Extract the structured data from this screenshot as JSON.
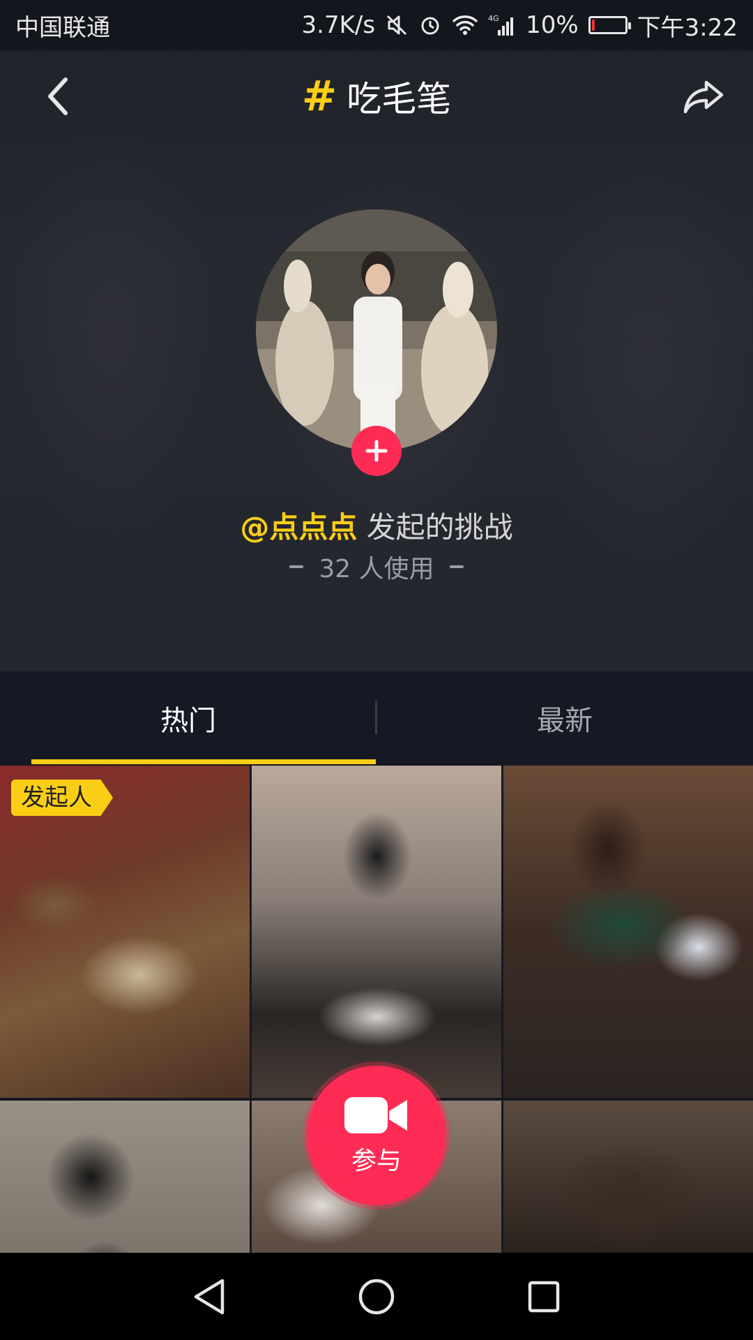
{
  "status_bar": {
    "carrier": "中国联通",
    "speed": "3.7K/s",
    "network": "4G",
    "battery_percent": "10%",
    "time": "下午3:22",
    "battery_level": 0.1
  },
  "header": {
    "hash_symbol": "#",
    "title": "吃毛笔"
  },
  "challenge": {
    "initiator_user": "@点点点",
    "initiator_suffix": " 发起的挑战",
    "usage_text": "32 人使用"
  },
  "tabs": [
    {
      "label": "热门",
      "active": true
    },
    {
      "label": "最新",
      "active": false
    }
  ],
  "grid": {
    "badge_label": "发起人",
    "videos": [
      {
        "name": "video-1"
      },
      {
        "name": "video-2"
      },
      {
        "name": "video-3"
      },
      {
        "name": "video-4"
      },
      {
        "name": "video-5"
      },
      {
        "name": "video-6"
      }
    ]
  },
  "join_button": {
    "label": "参与",
    "icon": "video-camera-icon"
  },
  "colors": {
    "accent_yellow": "#face15",
    "accent_red": "#fe2c55",
    "background": "#161823"
  },
  "system_nav": {
    "icons": [
      "back-triangle-icon",
      "home-circle-icon",
      "recents-square-icon"
    ]
  }
}
